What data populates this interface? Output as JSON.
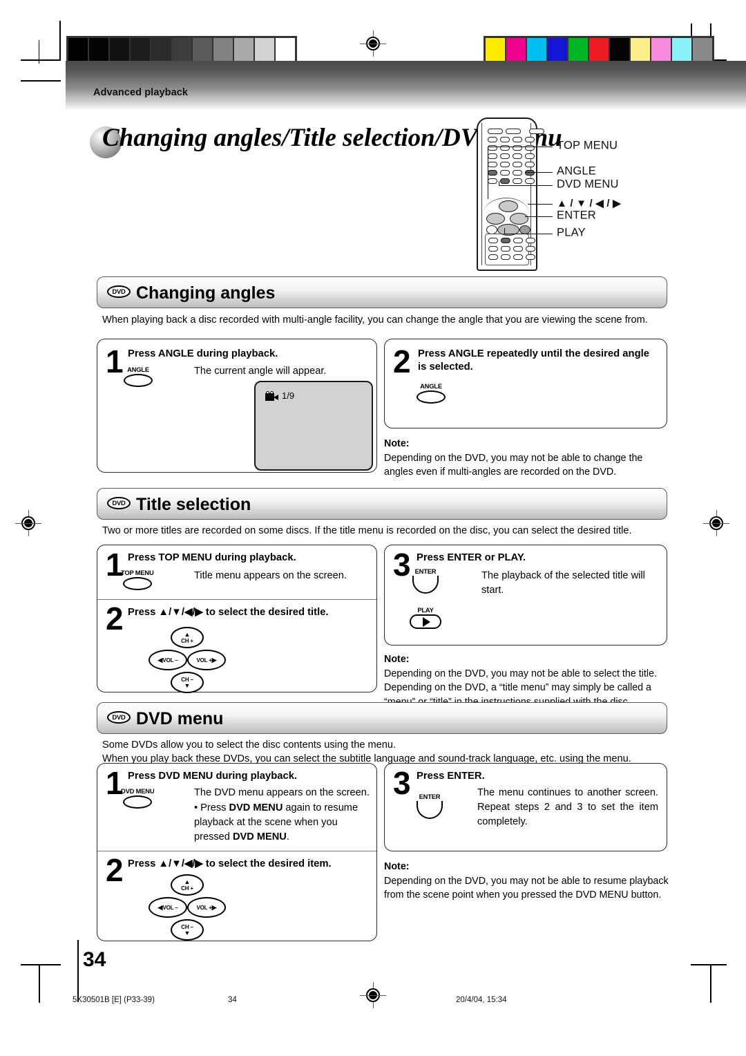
{
  "document": {
    "section_label": "Advanced playback",
    "page_title": "Changing angles/Title selection/DVD menu",
    "page_number": "34"
  },
  "remote_callouts": [
    {
      "label": "TOP MENU"
    },
    {
      "label": "ANGLE"
    },
    {
      "label": "DVD MENU"
    },
    {
      "label": "▲ / ▼ / ◀ / ▶"
    },
    {
      "label": "ENTER"
    },
    {
      "label": "PLAY"
    }
  ],
  "dvd_badge": "DVD",
  "sections": [
    {
      "id": "changing-angles",
      "heading": "Changing angles",
      "intro": "When playing back a disc recorded with multi-angle facility, you can change the angle that you are viewing the scene from.",
      "steps": [
        {
          "number": "1",
          "title": "Press ANGLE during playback.",
          "body": "The current angle will appear.",
          "key": "ANGLE"
        },
        {
          "number": "2",
          "title": "Press ANGLE repeatedly until the desired angle is selected.",
          "body": "",
          "key": "ANGLE"
        }
      ],
      "osd": {
        "angle_indicator": "1/9"
      },
      "note": {
        "label": "Note:",
        "text": "Depending on the DVD, you may not be able to change the angles even if multi-angles are recorded on the DVD."
      }
    },
    {
      "id": "title-selection",
      "heading": "Title selection",
      "intro": "Two or more titles are recorded on some discs. If the title menu is recorded on the disc, you can select the desired title.",
      "steps": [
        {
          "number": "1",
          "title": "Press TOP MENU during playback.",
          "body": "Title menu appears on the screen.",
          "key": "TOP MENU"
        },
        {
          "number": "2",
          "title": "Press ▲/▼/◀/▶ to select the desired title.",
          "body": "",
          "key": "dpad"
        },
        {
          "number": "3",
          "title": "Press ENTER or PLAY.",
          "body": "The playback of the selected title will start.",
          "key": "ENTER_PLAY"
        }
      ],
      "note": {
        "label": "Note:",
        "text": "Depending on the DVD, you may not be able to select the title. Depending on the DVD, a “title menu” may simply be called a “menu” or “title” in the instructions supplied with the disc."
      }
    },
    {
      "id": "dvd-menu",
      "heading": "DVD menu",
      "intro_line1": "Some DVDs allow you to select the disc contents using the menu.",
      "intro_line2": "When you play back these DVDs, you can select the subtitle language and sound-track language, etc. using the menu.",
      "steps": [
        {
          "number": "1",
          "title": "Press DVD MENU during playback.",
          "body": "The DVD menu appears on the screen.",
          "bullet_prefix": "• Press ",
          "bullet_bold1": "DVD MENU",
          "bullet_mid": " again to resume playback at the scene when you pressed ",
          "bullet_bold2": "DVD MENU",
          "bullet_end": ".",
          "key": "DVD MENU"
        },
        {
          "number": "2",
          "title": "Press ▲/▼/◀/▶ to select the desired item.",
          "body": "",
          "key": "dpad"
        },
        {
          "number": "3",
          "title": "Press ENTER.",
          "body": "The menu continues to another screen. Repeat steps 2 and 3 to set the item completely.",
          "key": "ENTER"
        }
      ],
      "note": {
        "label": "Note:",
        "text": "Depending on the DVD, you may not be able to resume playback from the scene point when you pressed the DVD MENU button."
      }
    }
  ],
  "dpad_labels": {
    "up": "CH +",
    "down": "CH –",
    "left": "VOL –",
    "right": "VOL +"
  },
  "footer": {
    "doc_code": "5K30501B [E] (P33-39)",
    "page": "34",
    "timestamp": "20/4/04, 15:34"
  },
  "calibration": {
    "grayscale": [
      "#000000",
      "#050505",
      "#111111",
      "#1c1c1c",
      "#2b2b2b",
      "#3d3d3d",
      "#5b5b5b",
      "#828282",
      "#a9a9a9",
      "#d2d2d2",
      "#ffffff"
    ],
    "colors": [
      "#ffed00",
      "#ec008c",
      "#00c0f3",
      "#1414d2",
      "#00b624",
      "#ed1c24",
      "#050505",
      "#fbee8b",
      "#f78bdd",
      "#8bf0f7",
      "#8a8a8a"
    ]
  }
}
